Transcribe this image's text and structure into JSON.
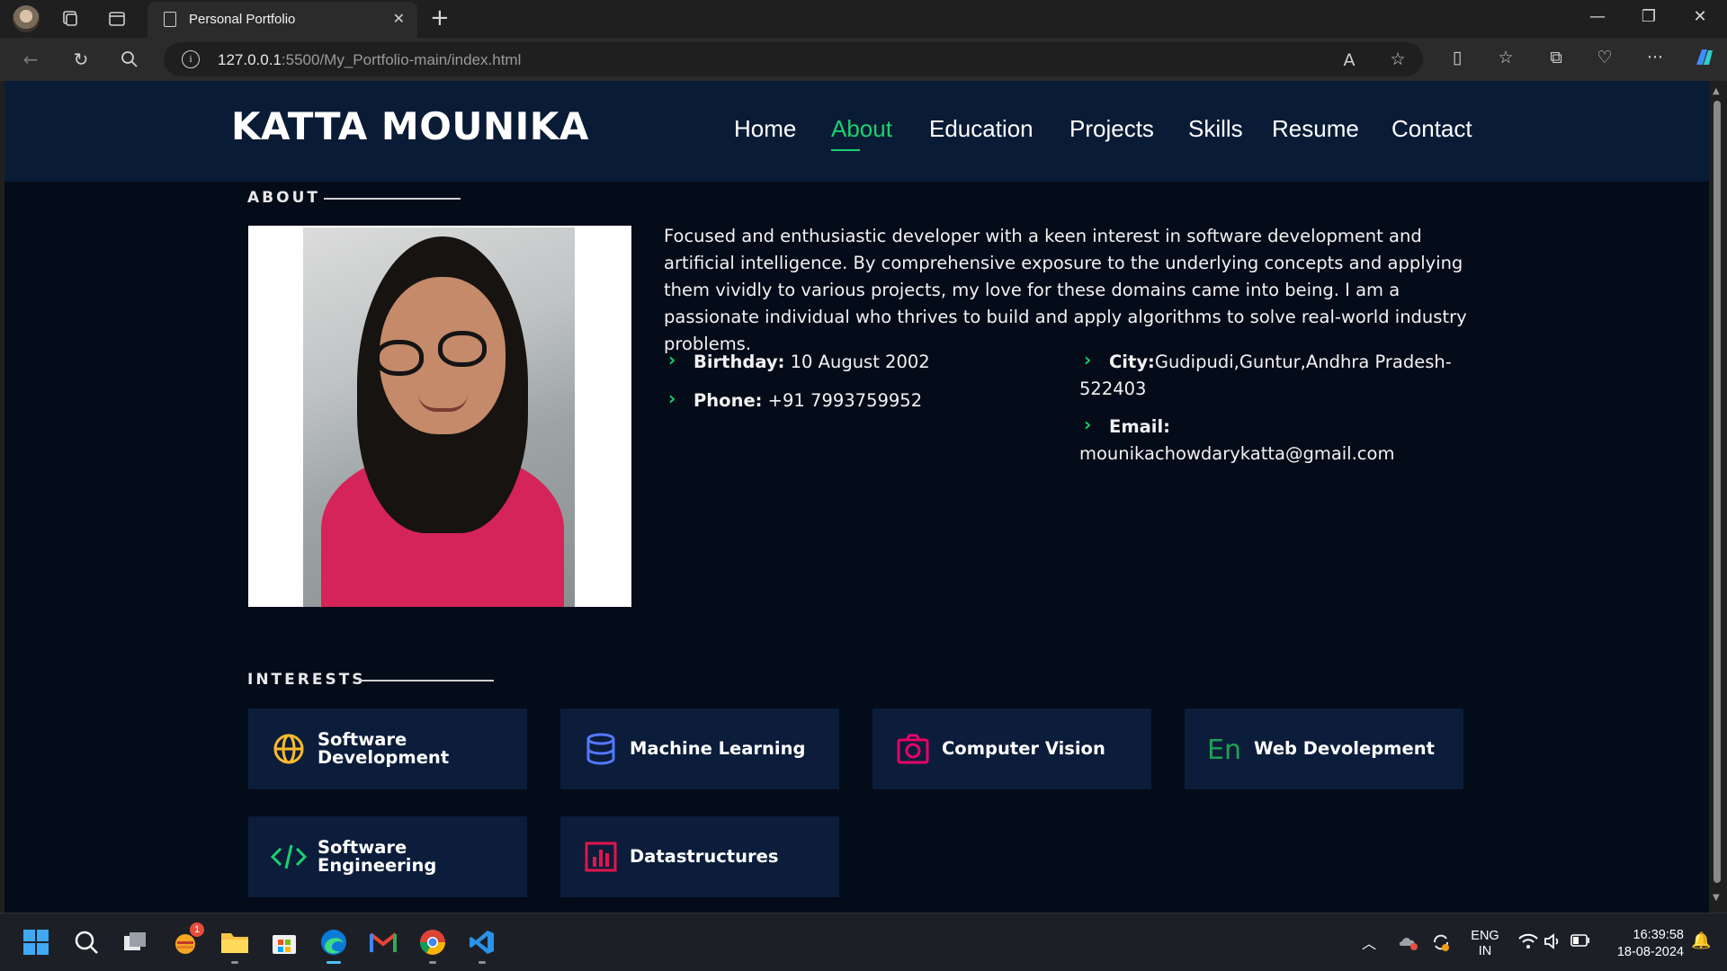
{
  "browser": {
    "tab_title": "Personal Portfolio",
    "url_host": "127.0.0.1",
    "url_rest": ":5500/My_Portfolio-main/index.html"
  },
  "site": {
    "brand": "KATTA MOUNIKA",
    "nav": [
      "Home",
      "About",
      "Education",
      "Projects",
      "Skills",
      "Resume",
      "Contact"
    ],
    "active_nav": "About",
    "accent_color": "#18d26e"
  },
  "about": {
    "section_title": "ABOUT",
    "intro": "Focused and enthusiastic developer with a keen interest in software development and artificial intelligence. By comprehensive exposure to the underlying concepts and applying them vividly to various projects, my love for these domains came into being. I am a passionate individual who thrives to build and apply algorithms to solve real-world industry problems.",
    "birthday_label": "Birthday:",
    "birthday_value": " 10 August 2002",
    "phone_label": "Phone:",
    "phone_value": " +91 7993759952",
    "city_label": "City:",
    "city_value": "Gudipudi,Guntur,Andhra Pradesh-",
    "city_value_2": "522403",
    "email_label": "Email:",
    "email_value": "mounikachowdarykatta@gmail.com"
  },
  "interests": {
    "section_title": "INTERESTS",
    "items": [
      {
        "label_1": "Software",
        "label_2": "Development",
        "icon": "globe-icon",
        "color": "#ffbb2c"
      },
      {
        "label_1": "Machine Learning",
        "label_2": "",
        "icon": "database-icon",
        "color": "#5578ff"
      },
      {
        "label_1": "Computer Vision",
        "label_2": "",
        "icon": "camera-icon",
        "color": "#e80368"
      },
      {
        "label_1": "Web Devolepment",
        "label_2": "",
        "icon": "language-icon",
        "color": "#1fa055"
      },
      {
        "label_1": "Software",
        "label_2": "Engineering",
        "icon": "code-icon",
        "color": "#18d26e"
      },
      {
        "label_1": "Datastructures",
        "label_2": "",
        "icon": "bar-chart-icon",
        "color": "#e2154d"
      }
    ]
  },
  "taskbar": {
    "notification_badge": "1",
    "lang_1": "ENG",
    "lang_2": "IN",
    "time": "16:39:58",
    "date": "18-08-2024"
  }
}
